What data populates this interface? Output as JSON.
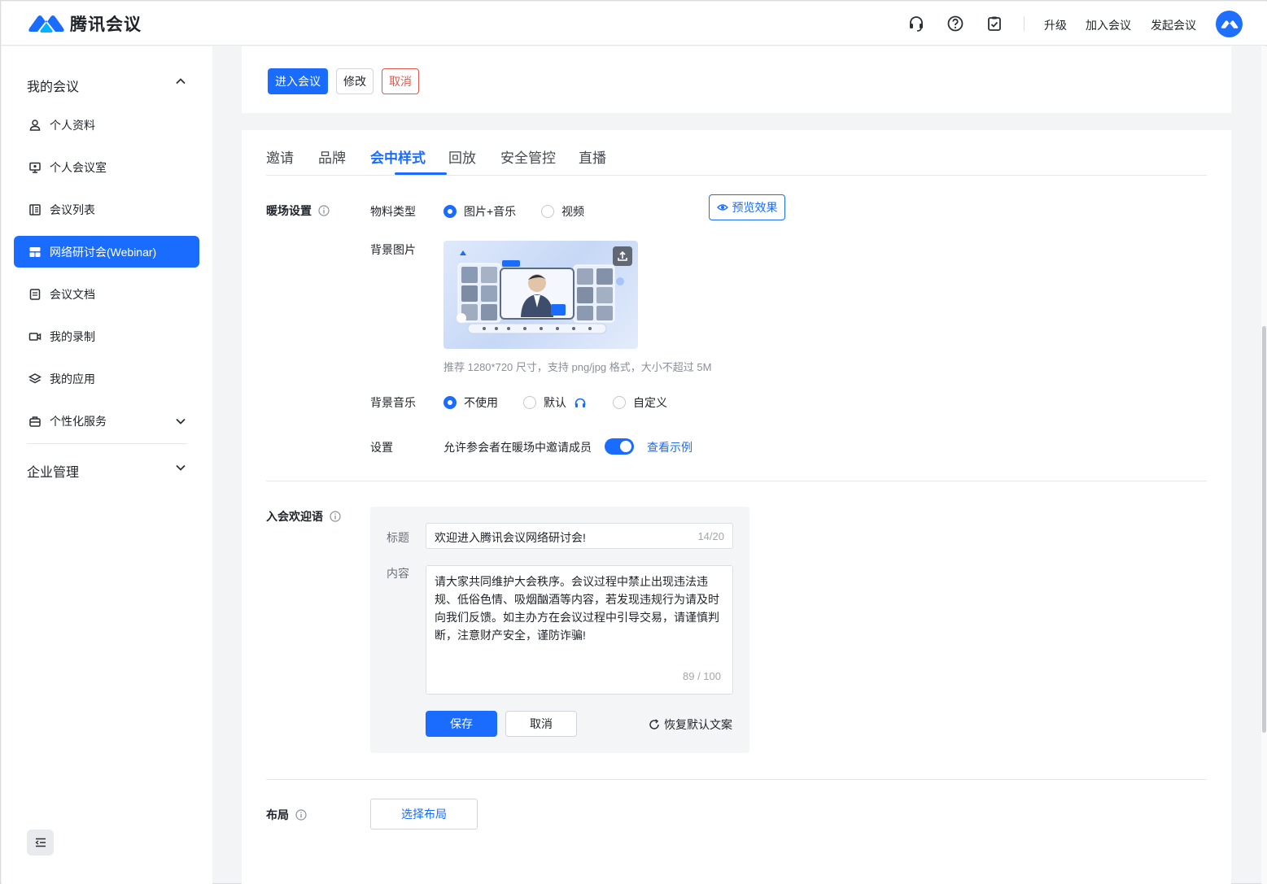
{
  "app": {
    "name": "腾讯会议"
  },
  "topbar": {
    "icons": [
      "headset-icon",
      "help-icon",
      "clipboard-check-icon"
    ],
    "links": {
      "upgrade": "升级",
      "join": "加入会议",
      "start": "发起会议"
    }
  },
  "sidebar": {
    "group_my_meetings": "我的会议",
    "items": [
      {
        "label": "个人资料",
        "icon": "user-icon"
      },
      {
        "label": "个人会议室",
        "icon": "monitor-icon"
      },
      {
        "label": "会议列表",
        "icon": "list-icon"
      },
      {
        "label": "网络研讨会(Webinar)",
        "icon": "webinar-icon",
        "active": true
      },
      {
        "label": "会议文档",
        "icon": "document-icon"
      },
      {
        "label": "我的录制",
        "icon": "video-camera-icon"
      },
      {
        "label": "我的应用",
        "icon": "layers-icon"
      },
      {
        "label": "个性化服务",
        "icon": "briefcase-icon"
      }
    ],
    "group_enterprise": "企业管理"
  },
  "actions": {
    "enter": "进入会议",
    "edit": "修改",
    "cancel": "取消"
  },
  "tabs": [
    {
      "label": "邀请"
    },
    {
      "label": "品牌"
    },
    {
      "label": "会中样式",
      "active": true
    },
    {
      "label": "回放"
    },
    {
      "label": "安全管控"
    },
    {
      "label": "直播"
    }
  ],
  "warmup": {
    "section_label": "暖场设置",
    "material_type_label": "物料类型",
    "material_options": [
      "图片+音乐",
      "视频"
    ],
    "material_selected": "图片+音乐",
    "preview_button": "预览效果",
    "bg_image_label": "背景图片",
    "bg_image_hint": "推荐 1280*720 尺寸，支持 png/jpg 格式，大小不超过 5M",
    "bg_music_label": "背景音乐",
    "music_options": [
      "不使用",
      "默认",
      "自定义"
    ],
    "music_selected": "不使用",
    "settings_label": "设置",
    "allow_invite_label": "允许参会者在暖场中邀请成员",
    "allow_invite_on": true,
    "see_example_link": "查看示例"
  },
  "welcome": {
    "section_label": "入会欢迎语",
    "title_label": "标题",
    "title_value": "欢迎进入腾讯会议网络研讨会!",
    "title_count": "14/20",
    "content_label": "内容",
    "content_value": "请大家共同维护大会秩序。会议过程中禁止出现违法违规、低俗色情、吸烟酗酒等内容，若发现违规行为请及时向我们反馈。如主办方在会议过程中引导交易，请谨慎判断，注意财产安全，谨防诈骗!",
    "content_count": "89 / 100",
    "save_button": "保存",
    "cancel_button": "取消",
    "restore_link": "恢复默认文案"
  },
  "layout": {
    "section_label": "布局",
    "choose_button": "选择布局"
  },
  "colors": {
    "primary": "#1a6cff",
    "danger": "#e8564b"
  }
}
